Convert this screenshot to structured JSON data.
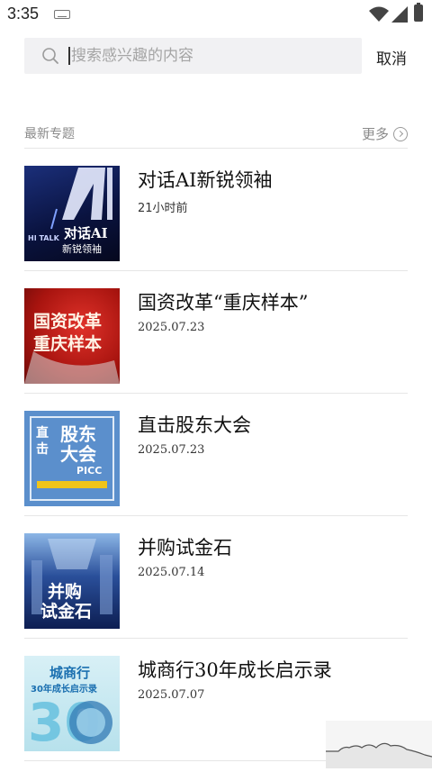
{
  "status_bar": {
    "time": "3:35"
  },
  "search": {
    "placeholder": "搜索感兴趣的内容",
    "value": "",
    "cancel_label": "取消"
  },
  "section": {
    "title": "最新专题",
    "more_label": "更多"
  },
  "topics": [
    {
      "title": "对话AI新锐领袖",
      "date": "21小时前",
      "thumb": {
        "label_main": "对话AI",
        "label_sub": "新锐领袖",
        "label_brand": "HI TALK",
        "bg": "#0b1a46"
      }
    },
    {
      "title": "国资改革“重庆样本”",
      "date": "2025.07.23",
      "thumb": {
        "line1": "国资改革",
        "line2": "重庆样本",
        "bg": "#b01812"
      }
    },
    {
      "title": "直击股东大会",
      "date": "2025.07.23",
      "thumb": {
        "line1": "股东",
        "line2": "大会",
        "side1": "直",
        "side2": "击",
        "brand": "PICC",
        "bg": "#4f86c6"
      }
    },
    {
      "title": "并购试金石",
      "date": "2025.07.14",
      "thumb": {
        "line1": "并购",
        "line2": "试金石",
        "bg": "#1f3a7a"
      }
    },
    {
      "title": "城商行30年成长启示录",
      "date": "2025.07.07",
      "thumb": {
        "line1": "城商行",
        "line2": "30年成长启示录",
        "big": "30",
        "bg": "#bfe5ef"
      }
    }
  ],
  "colors": {
    "accent": "#222222",
    "muted": "#8a8a8a",
    "search_bg": "#f1f1f3"
  }
}
